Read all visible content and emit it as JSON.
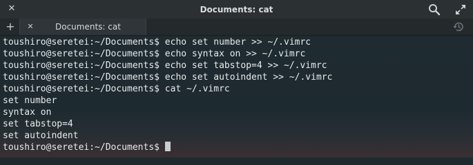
{
  "window": {
    "title": "Documents: cat"
  },
  "tabs": [
    {
      "label": "Documents: cat"
    }
  ],
  "terminal": {
    "lines": [
      "toushiro@seretei:~/Documents$ echo set number >> ~/.vimrc",
      "toushiro@seretei:~/Documents$ echo syntax on >> ~/.vimrc",
      "toushiro@seretei:~/Documents$ echo set tabstop=4 >> ~/.vimrc",
      "toushiro@seretei:~/Documents$ echo set autoindent >> ~/.vimrc",
      "toushiro@seretei:~/Documents$ cat ~/.vimrc",
      "set number",
      "syntax on",
      "set tabstop=4",
      "set autoindent",
      "toushiro@seretei:~/Documents$"
    ]
  },
  "icons": {
    "close": "close-icon",
    "search": "search-icon",
    "maximize": "maximize-icon",
    "new_tab": "plus-icon",
    "tab_close": "close-icon",
    "history": "history-icon"
  }
}
